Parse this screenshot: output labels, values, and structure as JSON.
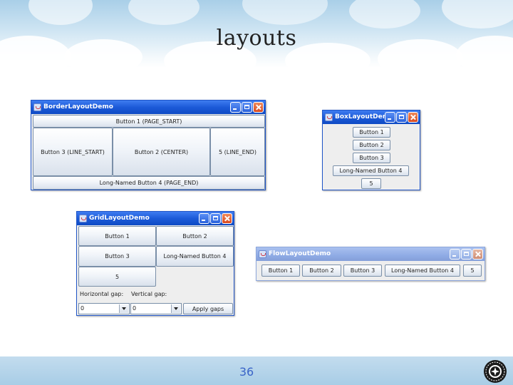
{
  "slide": {
    "title": "layouts",
    "page_number": "36"
  },
  "windows": {
    "border": {
      "title": "BorderLayoutDemo",
      "buttons": {
        "page_start": "Button 1 (PAGE_START)",
        "line_start": "Button 3 (LINE_START)",
        "center": "Button 2 (CENTER)",
        "line_end": "5 (LINE_END)",
        "page_end": "Long-Named Button 4 (PAGE_END)"
      }
    },
    "box": {
      "title": "BoxLayoutDemo",
      "buttons": [
        "Button 1",
        "Button 2",
        "Button 3",
        "Long-Named Button 4",
        "5"
      ]
    },
    "grid": {
      "title": "GridLayoutDemo",
      "buttons": [
        "Button 1",
        "Button 2",
        "Button 3",
        "Long-Named Button 4",
        "5"
      ],
      "horizontal_gap_label": "Horizontal gap:",
      "vertical_gap_label": "Vertical gap:",
      "horizontal_gap_value": "0",
      "vertical_gap_value": "0",
      "apply_label": "Apply gaps"
    },
    "flow": {
      "title": "FlowLayoutDemo",
      "buttons": [
        "Button 1",
        "Button 2",
        "Button 3",
        "Long-Named Button 4",
        "5"
      ]
    }
  },
  "icons": [
    "java-window-icon",
    "minimize-icon",
    "maximize-icon",
    "close-icon",
    "chevron-down-icon",
    "university-seal-logo"
  ],
  "colors": {
    "titlebar_active": "#1c5ad8",
    "titlebar_inactive": "#8fabe5",
    "close_button": "#d94a20",
    "page_number": "#3a64c8",
    "footer": "#a8cde6"
  }
}
